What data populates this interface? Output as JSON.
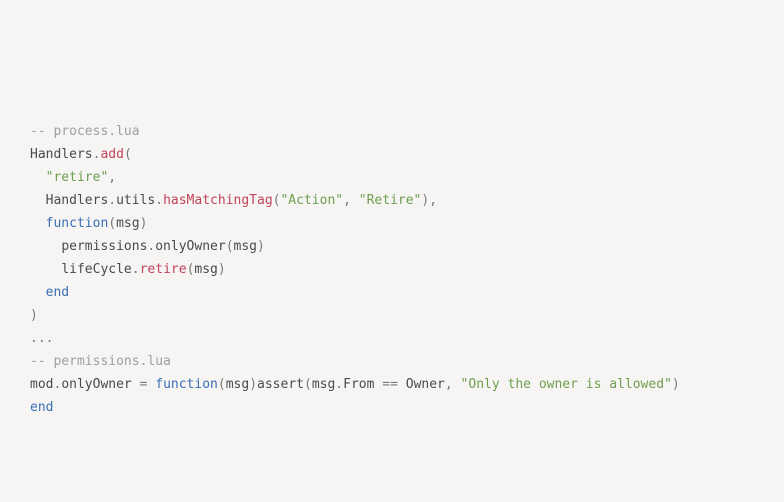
{
  "code": {
    "l1_comment": "-- process.lua",
    "l2": "",
    "l3_handlers": "Handlers",
    "l3_dot": ".",
    "l3_add": "add",
    "l3_paren": "(",
    "l4_indent": "  ",
    "l4_str": "\"retire\"",
    "l4_comma": ",",
    "l5_indent": "  ",
    "l5_handlers": "Handlers",
    "l5_dot1": ".",
    "l5_utils": "utils",
    "l5_dot2": ".",
    "l5_hasmatch": "hasMatchingTag",
    "l5_paren_o": "(",
    "l5_str1": "\"Action\"",
    "l5_comma1": ", ",
    "l5_str2": "\"Retire\"",
    "l5_paren_c": "),",
    "l6_indent": "  ",
    "l6_function": "function",
    "l6_paren_o": "(",
    "l6_msg": "msg",
    "l6_paren_c": ")",
    "l7_indent": "    ",
    "l7_perm": "permissions",
    "l7_dot": ".",
    "l7_only": "onlyOwner",
    "l7_paren_o": "(",
    "l7_msg": "msg",
    "l7_paren_c": ")",
    "l8_indent": "    ",
    "l8_life": "lifeCycle",
    "l8_dot": ".",
    "l8_retire": "retire",
    "l8_paren_o": "(",
    "l8_msg": "msg",
    "l8_paren_c": ")",
    "l9_indent": "  ",
    "l9_end": "end",
    "l10_paren": ")",
    "l11": "",
    "l12_dots": "...",
    "l13": "",
    "l14_comment": "-- permissions.lua",
    "l15": "",
    "l16_mod": "mod",
    "l16_dot": ".",
    "l16_only": "onlyOwner",
    "l16_eq": " = ",
    "l16_function": "function",
    "l16_paren_o1": "(",
    "l16_msg1": "msg",
    "l16_paren_c1": ")",
    "l16_assert": "assert",
    "l16_paren_o2": "(",
    "l16_msg2": "msg",
    "l16_dot2": ".",
    "l16_from": "From",
    "l16_eqeq": " == ",
    "l16_owner": "Owner",
    "l16_comma": ", ",
    "l16_str": "\"Only the owner is allowed\"",
    "l16_paren_c2": ") ",
    "l17_end": "end"
  }
}
